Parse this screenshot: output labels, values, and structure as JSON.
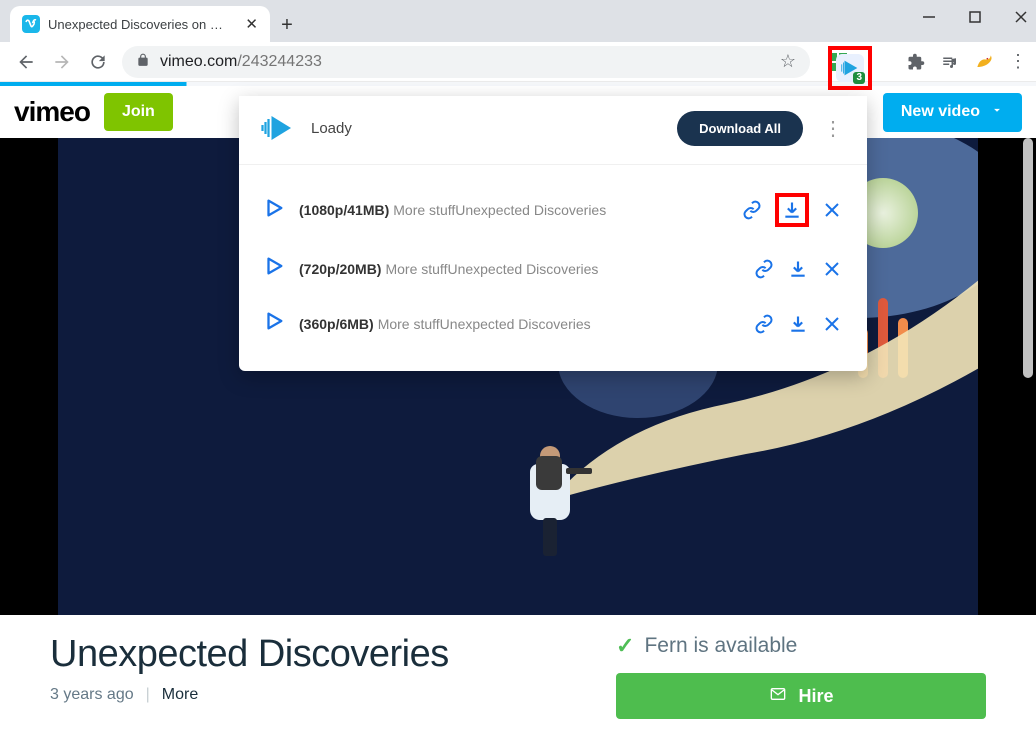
{
  "window": {
    "tab_title": "Unexpected Discoveries on Vime"
  },
  "address": {
    "host": "vimeo.com",
    "path": "/243244233"
  },
  "extension_badge": "3",
  "vimeo": {
    "logo_text": "vimeo",
    "join_label": "Join",
    "new_video_label": "New video"
  },
  "video": {
    "title": "Unexpected Discoveries",
    "age": "3 years ago",
    "more_label": "More"
  },
  "sidebar": {
    "availability_text": "Fern is available",
    "hire_label": "Hire"
  },
  "popup": {
    "app_name": "Loady",
    "download_all_label": "Download All",
    "items": [
      {
        "quality": "(1080p/41MB)",
        "desc": "More stuffUnexpected Discoveries"
      },
      {
        "quality": "(720p/20MB)",
        "desc": "More stuffUnexpected Discoveries"
      },
      {
        "quality": "(360p/6MB)",
        "desc": "More stuffUnexpected Discoveries"
      }
    ]
  }
}
